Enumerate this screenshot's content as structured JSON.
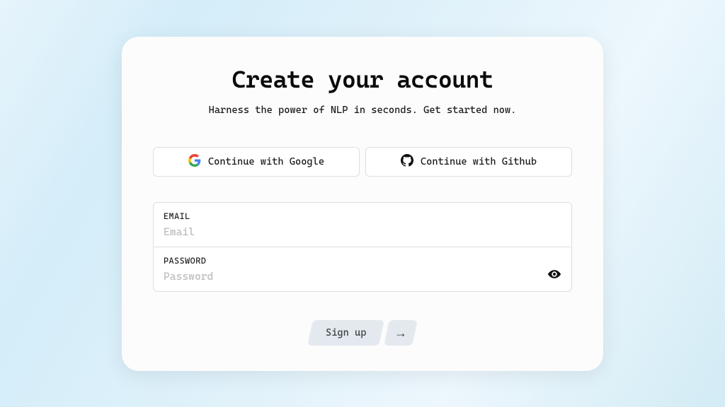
{
  "title": "Create your account",
  "subtitle": "Harness the power of NLP in seconds. Get started now.",
  "oauth": {
    "google_label": "Continue with Google",
    "github_label": "Continue with Github"
  },
  "form": {
    "email_label": "EMAIL",
    "email_placeholder": "Email",
    "email_value": "",
    "password_label": "PASSWORD",
    "password_placeholder": "Password",
    "password_value": ""
  },
  "actions": {
    "signup_label": "Sign up",
    "arrow_glyph": "→"
  }
}
